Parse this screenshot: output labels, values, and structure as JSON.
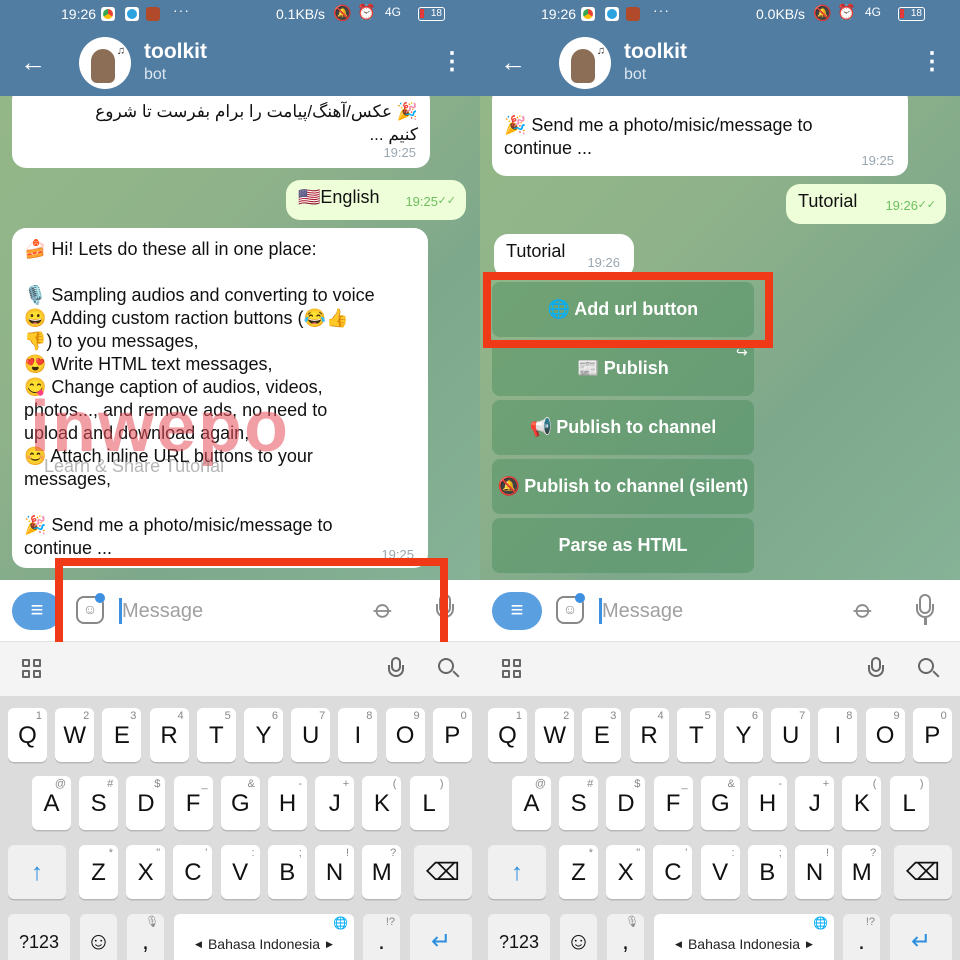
{
  "panels": [
    {
      "status_bar": {
        "time": "19:26",
        "net_speed": "0.1KB/s",
        "network": "4G",
        "battery": "18",
        "more": "···"
      },
      "header": {
        "title": "toolkit",
        "subtitle": "bot"
      },
      "messages": {
        "persian_lines": [
          "🎉 عکس/آهنگ/پیامت را برام بفرست تا شروع",
          "کنیم ..."
        ],
        "persian_time": "19:25",
        "english_reply": "🇺🇸English",
        "english_reply_time": "19:25",
        "welcome_lines": [
          "🍰 Hi! Lets do these all in one place:",
          "",
          "🎙️ Sampling audios and converting to voice",
          "😀 Adding custom raction buttons (😂👍",
          "👎) to you messages,",
          "😍 Write HTML text messages,",
          "😋 Change caption of audios, videos,",
          "photos..., and remove ads, no need to",
          "upload and download again,",
          "😊 Attach inline URL buttons to your",
          "messages,",
          "",
          "🎉 Send me a photo/misic/message to",
          "continue ..."
        ],
        "welcome_time": "19:25"
      },
      "watermark": {
        "brand": "inwepo",
        "tagline": "Learn & Share Tutorial"
      },
      "input": {
        "placeholder": "Message",
        "value": ""
      }
    },
    {
      "status_bar": {
        "time": "19:26",
        "net_speed": "0.0KB/s",
        "network": "4G",
        "battery": "18",
        "more": "···"
      },
      "header": {
        "title": "toolkit",
        "subtitle": "bot"
      },
      "messages": {
        "welcome_tail_lines": [
          "🎉 Send me a photo/misic/message to",
          "continue ..."
        ],
        "welcome_time": "19:25",
        "tutorial_out": "Tutorial",
        "tutorial_out_time": "19:26",
        "tutorial_in": "Tutorial",
        "tutorial_in_time": "19:26"
      },
      "inline_buttons": [
        {
          "emoji": "🌐",
          "label": "Add url button"
        },
        {
          "emoji": "📰",
          "label": "Publish"
        },
        {
          "emoji": "📢",
          "label": "Publish to channel"
        },
        {
          "emoji": "🔕",
          "label": "Publish to channel (silent)"
        },
        {
          "emoji": "",
          "label": "Parse as HTML"
        }
      ],
      "input": {
        "placeholder": "Message",
        "value": ""
      }
    }
  ],
  "icons": {
    "back": "←",
    "menu": "⋮",
    "bot_menu": "≡",
    "attach": "📎",
    "share": "↪",
    "read_check": "✓✓",
    "sticker": "☺"
  },
  "keyboard": {
    "row1": [
      {
        "k": "Q",
        "s": "1"
      },
      {
        "k": "W",
        "s": "2"
      },
      {
        "k": "E",
        "s": "3"
      },
      {
        "k": "R",
        "s": "4"
      },
      {
        "k": "T",
        "s": "5"
      },
      {
        "k": "Y",
        "s": "6"
      },
      {
        "k": "U",
        "s": "7"
      },
      {
        "k": "I",
        "s": "8"
      },
      {
        "k": "O",
        "s": "9"
      },
      {
        "k": "P",
        "s": "0"
      }
    ],
    "row2": [
      {
        "k": "A",
        "s": "@"
      },
      {
        "k": "S",
        "s": "#"
      },
      {
        "k": "D",
        "s": "$"
      },
      {
        "k": "F",
        "s": "_"
      },
      {
        "k": "G",
        "s": "&"
      },
      {
        "k": "H",
        "s": "-"
      },
      {
        "k": "J",
        "s": "+"
      },
      {
        "k": "K",
        "s": "("
      },
      {
        "k": "L",
        "s": ")"
      }
    ],
    "row3": [
      {
        "k": "Z",
        "s": "*"
      },
      {
        "k": "X",
        "s": "\""
      },
      {
        "k": "C",
        "s": "'"
      },
      {
        "k": "V",
        "s": ":"
      },
      {
        "k": "B",
        "s": ";"
      },
      {
        "k": "N",
        "s": "!"
      },
      {
        "k": "M",
        "s": "?"
      }
    ],
    "shift": "↑",
    "backspace": "⌫",
    "symbols": "?123",
    "emoji": "☺",
    "comma": ",",
    "period": ".",
    "period_sup": "!?",
    "space_label": "Bahasa Indonesia",
    "enter": "↵",
    "accent_color": "#2a8ee0"
  },
  "colors": {
    "header": "#517da2",
    "highlight": "#f03a17",
    "outgoing_bubble": "#eefed9",
    "bot_menu": "#5a9fe0"
  }
}
